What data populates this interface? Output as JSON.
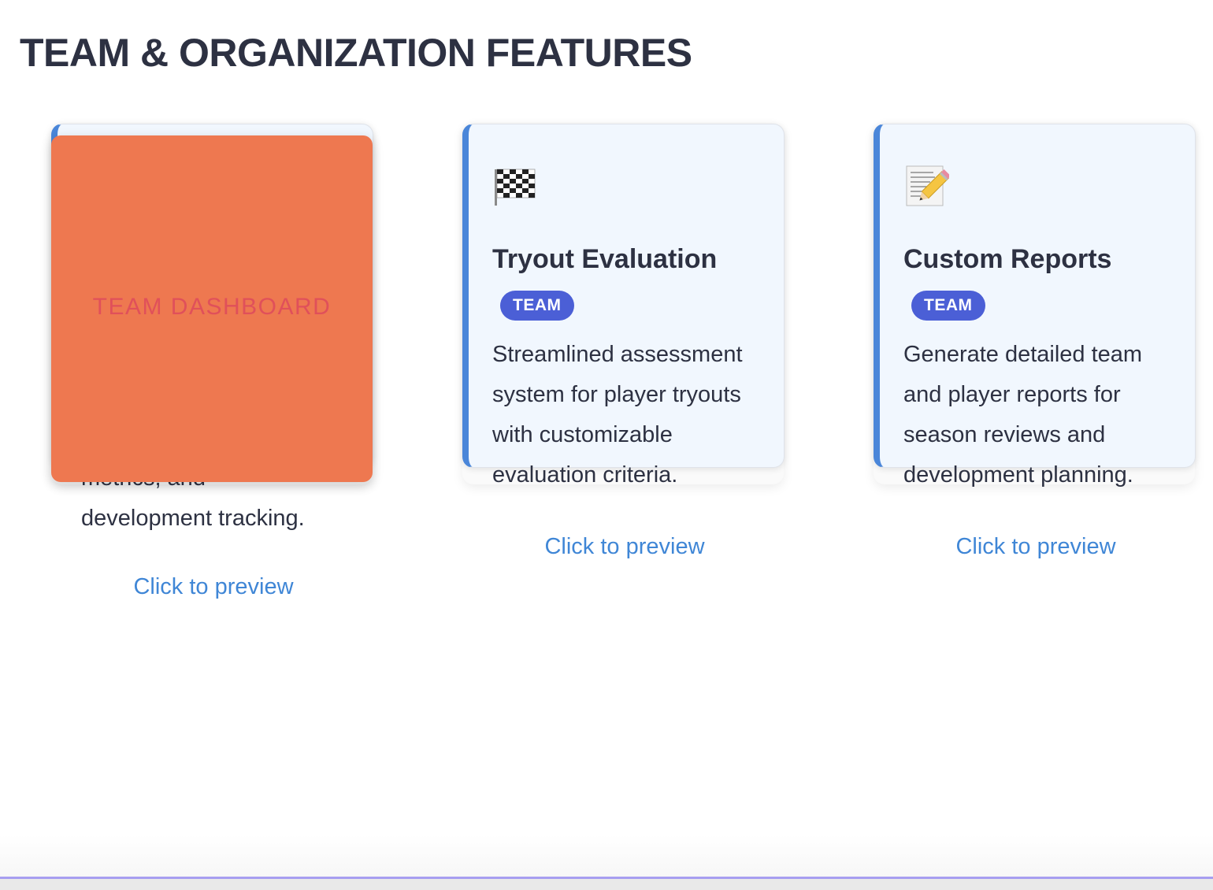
{
  "section": {
    "title": "TEAM & ORGANIZATION FEATURES"
  },
  "cards": [
    {
      "title": "Team Dashboard",
      "visible_text_lines": [
        "metrics, and",
        "development tracking."
      ],
      "preview_link": "Click to preview",
      "overlay_label": "TEAM DASHBOARD",
      "overlay_color": "#ee7850"
    },
    {
      "icon": "checkered-flag-icon",
      "title": "Tryout Evaluation",
      "badge": "TEAM",
      "description": "Streamlined assessment system for player tryouts with customizable evaluation criteria.",
      "preview_link": "Click to preview"
    },
    {
      "icon": "memo-pencil-icon",
      "title": "Custom Reports",
      "badge": "TEAM",
      "description": "Generate detailed team and player reports for season reviews and development planning.",
      "preview_link": "Click to preview"
    }
  ],
  "colors": {
    "accent_border": "#4a86d9",
    "badge_bg": "#4b5fd6",
    "link": "#3f86d6",
    "card_bg": "#f1f7fe",
    "bottom_bar": "#a79ef0"
  }
}
